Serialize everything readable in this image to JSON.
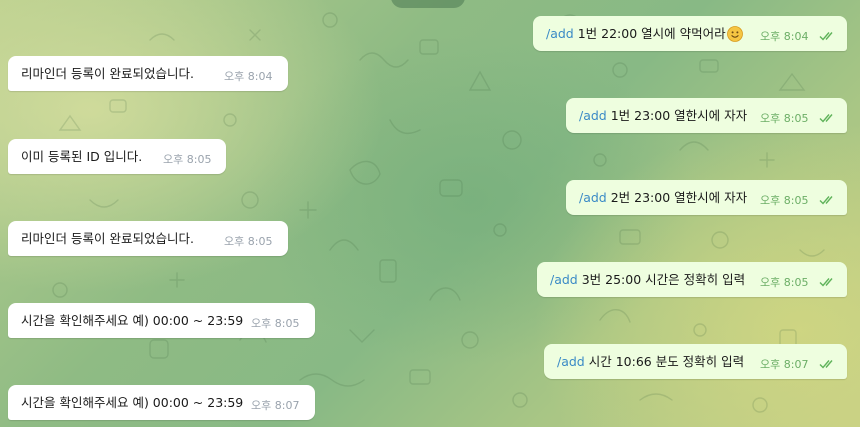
{
  "incoming": [
    {
      "text": "리마인더 등록이 완료되었습니다.",
      "time": "오후 8:04"
    },
    {
      "text": "이미 등록된 ID 입니다.",
      "time": "오후 8:05"
    },
    {
      "text": "리마인더 등록이 완료되었습니다.",
      "time": "오후 8:05"
    },
    {
      "text": "시간을 확인해주세요 예) 00:00 ~ 23:59",
      "time": "오후 8:05"
    },
    {
      "text": "시간을 확인해주세요 예) 00:00 ~ 23:59",
      "time": "오후 8:07"
    }
  ],
  "outgoing": [
    {
      "command": "/add",
      "text": " 1번 22:00 열시에 약먹어라",
      "emoji": "smiling-face-emoji",
      "time": "오후 8:04",
      "status": "read"
    },
    {
      "command": "/add",
      "text": " 1번 23:00 열한시에 자자",
      "time": "오후 8:05",
      "status": "read"
    },
    {
      "command": "/add",
      "text": " 2번 23:00 열한시에 자자",
      "time": "오후 8:05",
      "status": "read"
    },
    {
      "command": "/add",
      "text": " 3번 25:00 시간은 정확히 입력",
      "time": "오후 8:05",
      "status": "read"
    },
    {
      "command": "/add",
      "text": " 시간 10:66 분도 정확히 입력",
      "time": "오후 8:07",
      "status": "read"
    }
  ],
  "colors": {
    "incoming_bubble": "#ffffff",
    "outgoing_bubble": "#eefedf",
    "command_link": "#3a8ac6",
    "read_checks": "#5fb35a",
    "time_incoming": "#9aa3ad",
    "time_outgoing": "#6cae66"
  }
}
